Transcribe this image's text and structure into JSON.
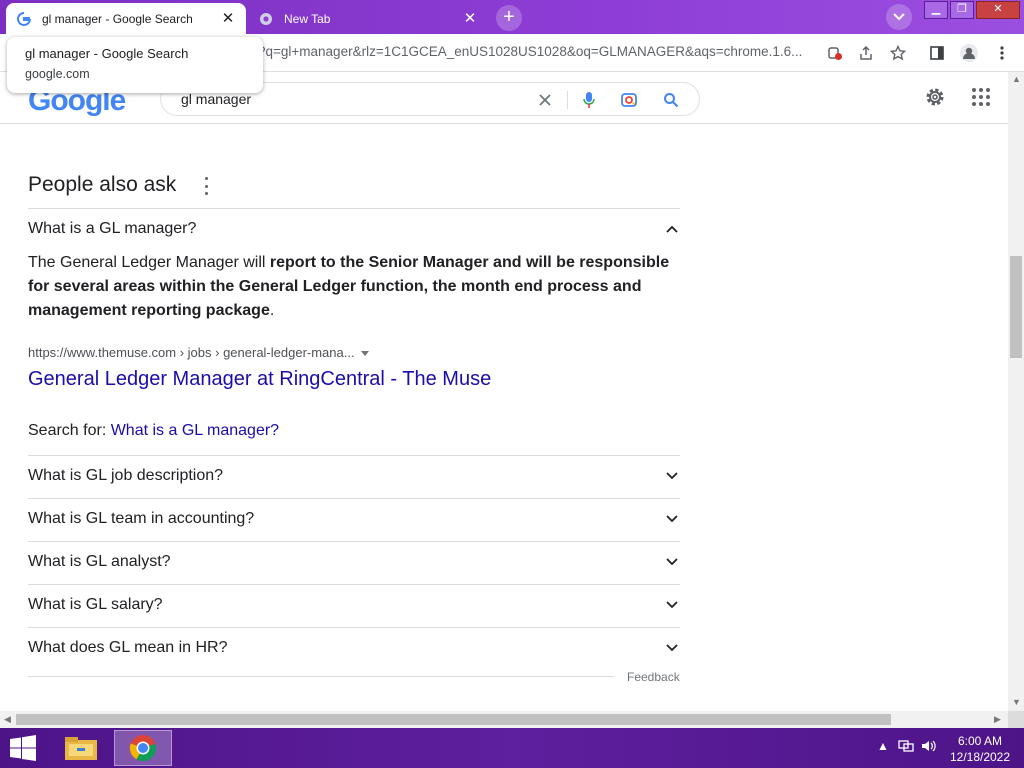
{
  "browser": {
    "tabs": [
      {
        "title": "gl manager - Google Search",
        "active": true
      },
      {
        "title": "New Tab",
        "active": false
      }
    ],
    "new_tab_label": "+",
    "url": "?q=gl+manager&rlz=1C1GCEA_enUS1028US1028&oq=GLMANAGER&aqs=chrome.1.6...",
    "tooltip": {
      "title": "gl manager - Google Search",
      "domain": "google.com"
    }
  },
  "google": {
    "logo": "Google",
    "query": "gl manager"
  },
  "paa": {
    "title": "People also ask",
    "expanded_question": "What is a GL manager?",
    "answer_lead": "The General Ledger Manager will ",
    "answer_bold": "report to the Senior Manager and will be responsible for several areas within the General Ledger function, the month end process and management reporting package",
    "answer_tail": ".",
    "cite": "https://www.themuse.com › jobs › general-ledger-mana...",
    "result_title": "General Ledger Manager at RingCentral - The Muse",
    "search_for_label": "Search for: ",
    "search_for_link": "What is a GL manager?",
    "questions": [
      "What is GL job description?",
      "What is GL team in accounting?",
      "What is GL analyst?",
      "What is GL salary?",
      "What does GL mean in HR?"
    ],
    "feedback": "Feedback"
  },
  "taskbar": {
    "time": "6:00 AM",
    "date": "12/18/2022"
  },
  "colors": {
    "link": "#1a0dab",
    "titlebar": "#8e3ed6",
    "taskbar": "#5f1f9e"
  }
}
